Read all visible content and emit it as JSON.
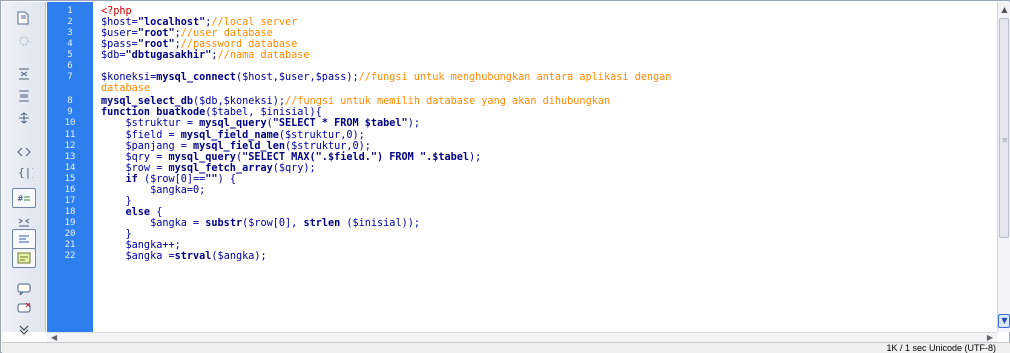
{
  "code": {
    "line_numbers": [
      "1",
      "2",
      "3",
      "4",
      "5",
      "6",
      "7",
      "8",
      "9",
      "10",
      "11",
      "12",
      "13",
      "14",
      "15",
      "16",
      "17",
      "18",
      "19",
      "20",
      "21",
      "22"
    ],
    "lines": [
      [
        {
          "t": "<?php",
          "c": "php"
        }
      ],
      [
        {
          "t": "$host=",
          "c": "var"
        },
        {
          "t": "\"localhost\"",
          "c": "str"
        },
        {
          "t": ";",
          "c": "pl"
        },
        {
          "t": "//local server",
          "c": "cmt"
        }
      ],
      [
        {
          "t": "$user=",
          "c": "var"
        },
        {
          "t": "\"root\"",
          "c": "str"
        },
        {
          "t": ";",
          "c": "pl"
        },
        {
          "t": "//user database",
          "c": "cmt"
        }
      ],
      [
        {
          "t": "$pass=",
          "c": "var"
        },
        {
          "t": "\"root\"",
          "c": "str"
        },
        {
          "t": ";",
          "c": "pl"
        },
        {
          "t": "//password database",
          "c": "cmt"
        }
      ],
      [
        {
          "t": "$db=",
          "c": "var"
        },
        {
          "t": "\"dbtugasakhir\"",
          "c": "str"
        },
        {
          "t": ";",
          "c": "pl"
        },
        {
          "t": "//nama database",
          "c": "cmt"
        }
      ],
      [],
      [
        {
          "t": "$koneksi=",
          "c": "var"
        },
        {
          "t": "mysql_connect",
          "c": "fn"
        },
        {
          "t": "($host,$user,$pass);",
          "c": "var"
        },
        {
          "t": "//fungsi untuk menghubungkan antara aplikasi dengan",
          "c": "cmt"
        }
      ],
      [
        {
          "t": "database",
          "c": "cmt"
        }
      ],
      [
        {
          "t": "mysql_select_db",
          "c": "fn"
        },
        {
          "t": "($db,$koneksi);",
          "c": "var"
        },
        {
          "t": "//fungsi untuk memilih database yang akan dihubungkan",
          "c": "cmt"
        }
      ],
      [
        {
          "t": "function buatkode",
          "c": "fn"
        },
        {
          "t": "($tabel, $inisial){",
          "c": "var"
        }
      ],
      [
        {
          "t": "    $struktur = ",
          "c": "var"
        },
        {
          "t": "mysql_query",
          "c": "fn"
        },
        {
          "t": "(",
          "c": "var"
        },
        {
          "t": "\"SELECT * FROM $tabel\"",
          "c": "strq"
        },
        {
          "t": ");",
          "c": "var"
        }
      ],
      [
        {
          "t": "    $field = ",
          "c": "var"
        },
        {
          "t": "mysql_field_name",
          "c": "fn"
        },
        {
          "t": "($struktur,0);",
          "c": "var"
        }
      ],
      [
        {
          "t": "    $panjang = ",
          "c": "var"
        },
        {
          "t": "mysql_field_len",
          "c": "fn"
        },
        {
          "t": "($struktur,0);",
          "c": "var"
        }
      ],
      [
        {
          "t": "    $qry = ",
          "c": "var"
        },
        {
          "t": "mysql_query",
          "c": "fn"
        },
        {
          "t": "(",
          "c": "var"
        },
        {
          "t": "\"SELECT MAX(\".$field.\") FROM \".$tabel",
          "c": "strq"
        },
        {
          "t": ");",
          "c": "var"
        }
      ],
      [
        {
          "t": "    $row = ",
          "c": "var"
        },
        {
          "t": "mysql_fetch_array",
          "c": "fn"
        },
        {
          "t": "($qry);",
          "c": "var"
        }
      ],
      [
        {
          "t": "    if ",
          "c": "fn"
        },
        {
          "t": "($row[0]==",
          "c": "var"
        },
        {
          "t": "\"\"",
          "c": "strq"
        },
        {
          "t": ") {",
          "c": "var"
        }
      ],
      [
        {
          "t": "        $angka=0;",
          "c": "var"
        }
      ],
      [
        {
          "t": "    }",
          "c": "var"
        }
      ],
      [
        {
          "t": "    else ",
          "c": "fn"
        },
        {
          "t": "{",
          "c": "var"
        }
      ],
      [
        {
          "t": "        $angka = ",
          "c": "var"
        },
        {
          "t": "substr",
          "c": "fn"
        },
        {
          "t": "($row[0], ",
          "c": "var"
        },
        {
          "t": "strlen ",
          "c": "fn"
        },
        {
          "t": "($inisial));",
          "c": "var"
        }
      ],
      [
        {
          "t": "    }",
          "c": "var"
        }
      ],
      [
        {
          "t": "    $angka++;",
          "c": "var"
        }
      ],
      [
        {
          "t": "    $angka =",
          "c": "var"
        },
        {
          "t": "strval",
          "c": "fn"
        },
        {
          "t": "($angka);",
          "c": "var"
        }
      ]
    ],
    "line_index_map": [
      0,
      1,
      2,
      3,
      4,
      5,
      6,
      -1,
      7,
      8,
      9,
      10,
      11,
      12,
      13,
      14,
      15,
      16,
      17,
      18,
      19,
      20,
      21
    ]
  },
  "colors": {
    "gutter": "#2d7ff0",
    "string": "#000080",
    "comment": "#ff8a00",
    "php_tag": "#cc0000"
  },
  "toolbar": {
    "icons": [
      "open-documents-icon",
      "show-code-navigator-icon",
      "collapse-full-tag-icon",
      "collapse-selection-icon",
      "expand-all-icon",
      "select-parent-tag-icon",
      "balance-braces-icon",
      "line-numbers-icon",
      "highlight-invalid-code-icon",
      "syntax-coloring-icon",
      "word-wrap-icon",
      "apply-comment-icon",
      "remove-comment-icon",
      "more-icon"
    ]
  },
  "status": {
    "text": "1K / 1 sec  Unicode (UTF-8)"
  }
}
